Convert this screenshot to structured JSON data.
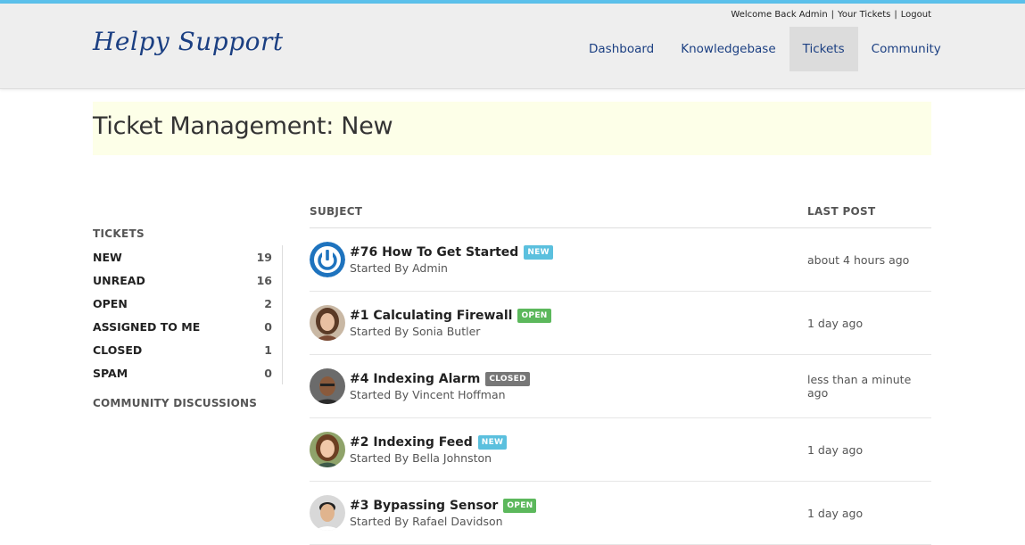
{
  "header": {
    "logo": "Helpy Support",
    "util": {
      "welcome": "Welcome Back Admin",
      "your_tickets": "Your Tickets",
      "logout": "Logout",
      "separator": "|"
    },
    "nav": [
      {
        "label": "Dashboard",
        "active": false
      },
      {
        "label": "Knowledgebase",
        "active": false
      },
      {
        "label": "Tickets",
        "active": true
      },
      {
        "label": "Community",
        "active": false
      }
    ]
  },
  "page": {
    "title": "Ticket Management: New"
  },
  "sidebar": {
    "heading": "TICKETS",
    "items": [
      {
        "label": "NEW",
        "count": "19"
      },
      {
        "label": "UNREAD",
        "count": "16"
      },
      {
        "label": "OPEN",
        "count": "2"
      },
      {
        "label": "ASSIGNED TO ME",
        "count": "0"
      },
      {
        "label": "CLOSED",
        "count": "1"
      },
      {
        "label": "SPAM",
        "count": "0"
      }
    ],
    "community": "COMMUNITY DISCUSSIONS"
  },
  "table": {
    "headers": {
      "subject": "SUBJECT",
      "last_post": "LAST POST"
    },
    "rows": [
      {
        "title": "#76 How To Get Started",
        "badge": "NEW",
        "badge_type": "new",
        "started_by": "Started By Admin",
        "last_post": "about 4 hours ago",
        "avatar": "power-logo"
      },
      {
        "title": "#1 Calculating Firewall",
        "badge": "OPEN",
        "badge_type": "open",
        "started_by": "Started By Sonia Butler",
        "last_post": "1 day ago",
        "avatar": "woman-1"
      },
      {
        "title": "#4 Indexing Alarm",
        "badge": "CLOSED",
        "badge_type": "closed",
        "started_by": "Started By Vincent Hoffman",
        "last_post": "less than a minute ago",
        "avatar": "man-1"
      },
      {
        "title": "#2 Indexing Feed",
        "badge": "NEW",
        "badge_type": "new",
        "started_by": "Started By Bella Johnston",
        "last_post": "1 day ago",
        "avatar": "woman-2"
      },
      {
        "title": "#3 Bypassing Sensor",
        "badge": "OPEN",
        "badge_type": "open",
        "started_by": "Started By Rafael Davidson",
        "last_post": "1 day ago",
        "avatar": "man-2"
      }
    ]
  },
  "colors": {
    "accent": "#5bc0eb",
    "brand": "#1b3f82",
    "badge_new": "#5bc0de",
    "badge_open": "#5cb85c",
    "badge_closed": "#777777",
    "banner": "#fdffe8"
  }
}
